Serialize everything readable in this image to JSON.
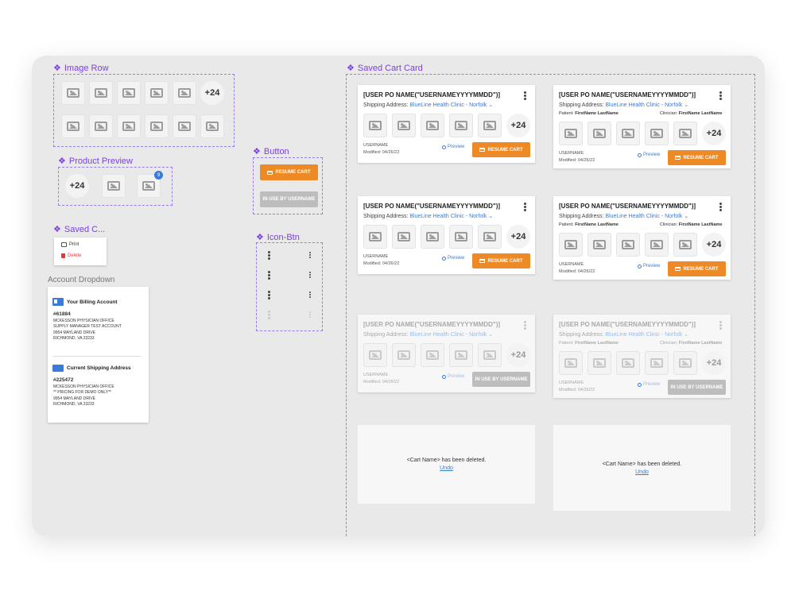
{
  "sections": {
    "image_row": "Image Row",
    "product_preview": "Product Preview",
    "saved_c": "Saved C...",
    "account_dropdown": "Account Dropdown",
    "button": "Button",
    "icon_btn": "Icon-Btn",
    "saved_cart_card": "Saved Cart Card"
  },
  "image_row": {
    "more_count": "+24"
  },
  "product_preview": {
    "more_count": "+24",
    "badge": "9"
  },
  "saved_menu": {
    "print_label": "Print",
    "delete_label": "Delete"
  },
  "account": {
    "billing_title": "Your Billing Account",
    "billing_number": "#61884",
    "billing_lines": [
      "MCKESSON PHYSICIAN OFFICE",
      "SUPPLY MANAGER TEST ACCOUNT",
      "9954 MAYLAND DRIVE",
      "RICHMOND, VA 23233"
    ],
    "shipping_title": "Current Shipping Address",
    "shipping_number": "#225472",
    "shipping_lines": [
      "MCKESSON PHYSICIAN OFFICE",
      "** PRICING FOR DEMO ONLY**",
      "9954 MAYLAND DRIVE",
      "RICHMOND, VA 23233"
    ]
  },
  "buttons": {
    "resume_cart": "RESUME CART",
    "in_use": "IN USE BY USERNAME"
  },
  "card": {
    "po_name": "[USER PO NAME(\"USERNAMEYYYYMMDD\")]",
    "ship_label": "Shipping Address:",
    "ship_link": "BlueLine Health Clinic - Norfolk",
    "patient_label": "Patient:",
    "patient_name": "FirstName LastName",
    "clinician_label": "Clinician:",
    "clinician_name": "FirstName LastName",
    "username": "USERNAME",
    "modified": "Modified: 04/26/22",
    "preview": "Preview",
    "more_count": "+24",
    "deleted_text": "<Cart Name> has been deleted.",
    "undo": "Undo"
  },
  "colors": {
    "accent_orange": "#ee8a25",
    "link_blue": "#3a7bd5",
    "section_purple": "#7b3fe4"
  },
  "icons": [
    "image-icon",
    "cart-icon",
    "search-icon",
    "kebab-icon",
    "printer-icon",
    "trash-icon",
    "id-card-icon",
    "truck-icon",
    "component-diamond-icon",
    "chevron-down-icon"
  ]
}
